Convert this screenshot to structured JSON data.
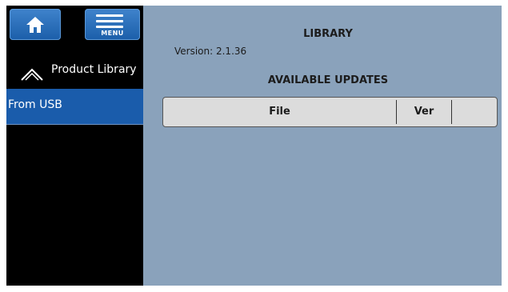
{
  "sidebar": {
    "home_icon": "home-icon",
    "menu_label": "MENU",
    "back_item_label": "Product Library",
    "selected_item_label": "From USB"
  },
  "main": {
    "title": "LIBRARY",
    "version": "Version: 2.1.36",
    "updates_title": "AVAILABLE UPDATES",
    "table": {
      "columns": [
        "File",
        "Ver",
        ""
      ]
    }
  },
  "colors": {
    "sidebar_bg": "#000000",
    "accent_blue": "#1a5cab",
    "main_bg": "#8aa2bb",
    "header_bg": "#dcdcdc"
  }
}
